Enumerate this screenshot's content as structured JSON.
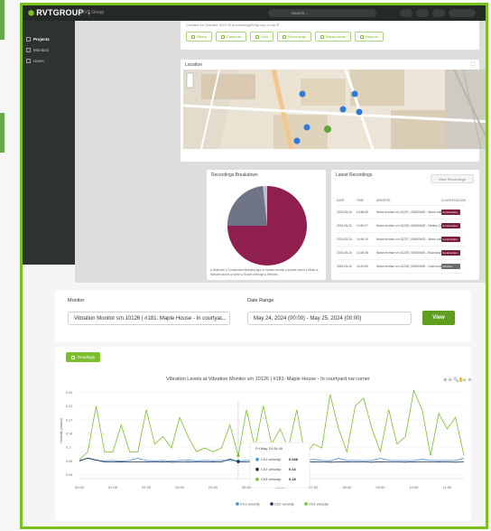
{
  "header": {
    "logo": "RVTGROUP",
    "org": "RVT Group",
    "search_placeholder": "Search..."
  },
  "sidebar": {
    "items": [
      {
        "label": "Projects",
        "active": true
      },
      {
        "label": "Monitors",
        "active": false
      },
      {
        "label": "Users",
        "active": false
      }
    ]
  },
  "project": {
    "contact_line": "Created for October 2021 ✉ monitoring@rvtgroup.co.uk ✆",
    "tabs": [
      "Filters",
      "Calendar",
      "Grid",
      "Recordings",
      "Breakdowns",
      "Reports"
    ]
  },
  "location": {
    "title": "Location",
    "map_markers": [
      "3",
      "1",
      "2",
      "3",
      "8",
      "3"
    ]
  },
  "breakdown": {
    "title": "Recordings Breakdown",
    "legend": "● Unknown ● Construction/Industry type ● Human sounds ● Impact sound ● Music ● Natural sounds ● Noise ● Sound of things ● Vehicles"
  },
  "latest": {
    "title": "Latest Recordings",
    "button": "View Recordings",
    "columns": [
      "DATE",
      "TIME",
      "MONITOR",
      "CLASSIFICATION"
    ],
    "rows": [
      {
        "date": "2024-05-24",
        "time": "14:56:55",
        "monitor": "Noise monitor s/n 10237 | SM300#02 - Wrest unit",
        "class": "Construction",
        "grey": false
      },
      {
        "date": "2024-05-24",
        "time": "14:52:07",
        "monitor": "Noise monitor s/n 10235 | SM300#02 - Hurtley Center",
        "class": "Construction",
        "grey": false
      },
      {
        "date": "2024-05-24",
        "time": "14:49:16",
        "monitor": "Noise monitor s/n 10237 | SM300#02 - Wrest unit",
        "class": "Construction",
        "grey": false
      },
      {
        "date": "2024-05-24",
        "time": "14:46:46",
        "monitor": "Noise monitor s/n 10235 | SM300#02 - Boundary wall",
        "class": "Construction",
        "grey": false
      },
      {
        "date": "2024-05-24",
        "time": "14:41:59",
        "monitor": "Noise monitor s/n 10235 | SM300#02 - Gate house",
        "class": "Vehicles",
        "grey": true
      }
    ]
  },
  "selection": {
    "monitor_label": "Monitor",
    "monitor_value": "Vibration Monitor s/n 10126 | #181: Maple House - In courtyar...",
    "date_label": "Date Range",
    "date_value": "May 24, 2024 (00:00) - May 25, 2024 (00:00)",
    "view_button": "View"
  },
  "readings_button": "Readings",
  "chart_toolbar_icons": [
    "zoom-in-icon",
    "zoom-out-icon",
    "magnify-icon",
    "pan-icon",
    "home-icon",
    "menu-icon"
  ],
  "tooltip": {
    "title": "Fri May 24 04:45",
    "rows": [
      {
        "label": "Ch1 velocity:",
        "value": "0.048",
        "color": "#3d8fd8"
      },
      {
        "label": "Ch2 velocity:",
        "value": "0.14",
        "color": "#1c2d4a"
      },
      {
        "label": "Ch3 velocity:",
        "value": "0.18",
        "color": "#7bbf2a"
      }
    ]
  },
  "colors": {
    "accent": "#79c11f",
    "ch1": "#3d8fd8",
    "ch2": "#1c2d4a",
    "ch3": "#7bbf2a",
    "header": "#262a26",
    "badge": "#7b1d3e"
  },
  "chart_data": {
    "type": "line",
    "title": "Vibration Levels at Vibration Monitor s/n 10126 | #181: Maple House - In courtyard nw corner",
    "xlabel": "",
    "ylabel": "Velocity (mm/s)",
    "x_ticks": [
      "00:00",
      "01:00",
      "02:00",
      "03:00",
      "04:00",
      "05:00",
      "06:00",
      "07:00",
      "08:00",
      "09:00",
      "10:00",
      "11:00"
    ],
    "y_ticks": [
      "0.04",
      "0.06",
      "0.1",
      "0.14",
      "0.17",
      "0.22",
      "0.25"
    ],
    "ylim": [
      0,
      0.25
    ],
    "x": [
      0,
      0.25,
      0.5,
      0.75,
      1,
      1.25,
      1.5,
      1.75,
      2,
      2.25,
      2.5,
      2.75,
      3,
      3.25,
      3.5,
      3.75,
      4,
      4.25,
      4.5,
      4.75,
      5,
      5.25,
      5.5,
      5.75,
      6,
      6.25,
      6.5,
      6.75,
      7,
      7.25,
      7.5,
      7.75,
      8,
      8.25,
      8.5,
      8.75,
      9,
      9.25,
      9.5,
      9.75,
      10,
      10.25,
      10.5,
      10.75,
      11,
      11.25,
      11.5
    ],
    "series": [
      {
        "name": "Ch1 velocity",
        "values": [
          0.05,
          0.06,
          0.05,
          0.048,
          0.05,
          0.047,
          0.05,
          0.06,
          0.05,
          0.048,
          0.05,
          0.047,
          0.05,
          0.052,
          0.048,
          0.05,
          0.049,
          0.05,
          0.05,
          0.048,
          0.05,
          0.052,
          0.051,
          0.06,
          0.05,
          0.05,
          0.049,
          0.05,
          0.055,
          0.05,
          0.048,
          0.06,
          0.05,
          0.05,
          0.049,
          0.05,
          0.06,
          0.05,
          0.05,
          0.049,
          0.05,
          0.055,
          0.05,
          0.05,
          0.05,
          0.05,
          0.06
        ]
      },
      {
        "name": "Ch2 velocity",
        "values": [
          0.05,
          0.065,
          0.055,
          0.045,
          0.045,
          0.046,
          0.045,
          0.045,
          0.046,
          0.045,
          0.046,
          0.044,
          0.045,
          0.046,
          0.045,
          0.045,
          0.046,
          0.045,
          0.06,
          0.046,
          0.045,
          0.044,
          0.045,
          0.046,
          0.045,
          0.044,
          0.045,
          0.045,
          0.046,
          0.045,
          0.044,
          0.045,
          0.046,
          0.045,
          0.045,
          0.044,
          0.046,
          0.045,
          0.045,
          0.044,
          0.046,
          0.045,
          0.045,
          0.046,
          0.045,
          0.044,
          0.045
        ]
      },
      {
        "name": "Ch3 velocity",
        "values": [
          0.05,
          0.07,
          0.19,
          0.07,
          0.07,
          0.14,
          0.07,
          0.07,
          0.18,
          0.09,
          0.11,
          0.08,
          0.16,
          0.11,
          0.07,
          0.08,
          0.07,
          0.08,
          0.14,
          0.06,
          0.18,
          0.08,
          0.19,
          0.09,
          0.13,
          0.08,
          0.18,
          0.06,
          0.09,
          0.08,
          0.22,
          0.13,
          0.07,
          0.19,
          0.21,
          0.13,
          0.07,
          0.18,
          0.09,
          0.11,
          0.23,
          0.18,
          0.06,
          0.17,
          0.13,
          0.16,
          0.06
        ]
      }
    ],
    "legend_position": "bottom"
  }
}
